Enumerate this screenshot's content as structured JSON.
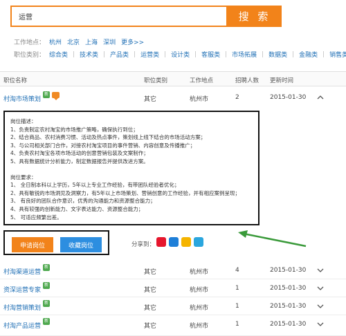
{
  "search": {
    "value": "运营",
    "button_label": "搜 索"
  },
  "filters": {
    "location_label": "工作地点：",
    "locations": [
      "杭州",
      "北京",
      "上海",
      "深圳",
      "更多>>"
    ],
    "category_label": "职位类别：",
    "categories": [
      "综合类",
      "技术类",
      "产品类",
      "运营类",
      "设计类",
      "客服类",
      "市场拓展",
      "数据类",
      "金融类",
      "销售类"
    ]
  },
  "table": {
    "headers": [
      "职位名称",
      "职位类别",
      "工作地点",
      "招聘人数",
      "更新时间"
    ],
    "expanded_row": {
      "title": "村淘市场策划",
      "type": "其它",
      "location": "杭州市",
      "count": "2",
      "date": "2015-01-30"
    },
    "rows": [
      {
        "title": "村淘渠道运营",
        "type": "其它",
        "location": "杭州市",
        "count": "4",
        "date": "2015-01-30"
      },
      {
        "title": "资深运营专家",
        "type": "其它",
        "location": "杭州市",
        "count": "1",
        "date": "2015-01-30"
      },
      {
        "title": "村淘营销策划",
        "type": "其它",
        "location": "杭州市",
        "count": "1",
        "date": "2015-01-30"
      },
      {
        "title": "村淘产品运营",
        "type": "其它",
        "location": "杭州市",
        "count": "1",
        "date": "2015-01-30"
      }
    ],
    "new_badge": "新"
  },
  "description": {
    "duty_title": "岗位描述：",
    "duties": [
      "1、负责制定农村淘宝的市场推广策略，确保执行到位；",
      "2、结合商品、农村消费习惯、活动及热点事件，策划线上线下结合的市场活动方案；",
      "3、与公司相关部门合作，对接农村淘宝项目的事件营销、内容创意及传播推广；",
      "4、负责农村淘宝各项市场活动的创意营销包装及文案制作；",
      "5、具有数据统计分析能力，制定数据报告并提供改进方案。"
    ],
    "req_title": "岗位要求：",
    "requirements": [
      "1、 全日制本科以上学历，5年以上专业工作经验，有带团队经验者优化；",
      "2、具有敏锐的市场洞见及洞察力，有5年以上市场策划、营销创意的工作经验，并有相应案例呈现；",
      "3、 有良好的团队合作意识，优秀的沟通能力和资源整合能力；",
      "4、具有较强的创新能力、文字表达能力、资源整合能力；",
      "5、 可适应频繁出差。"
    ]
  },
  "actions": {
    "apply_label": "申请岗位",
    "save_label": "收藏岗位",
    "share_label": "分享到："
  },
  "colors": {
    "accent": "#f2831a",
    "link": "#1f6fb5",
    "save": "#2d8ee0",
    "new_badge": "#4ea84e"
  }
}
